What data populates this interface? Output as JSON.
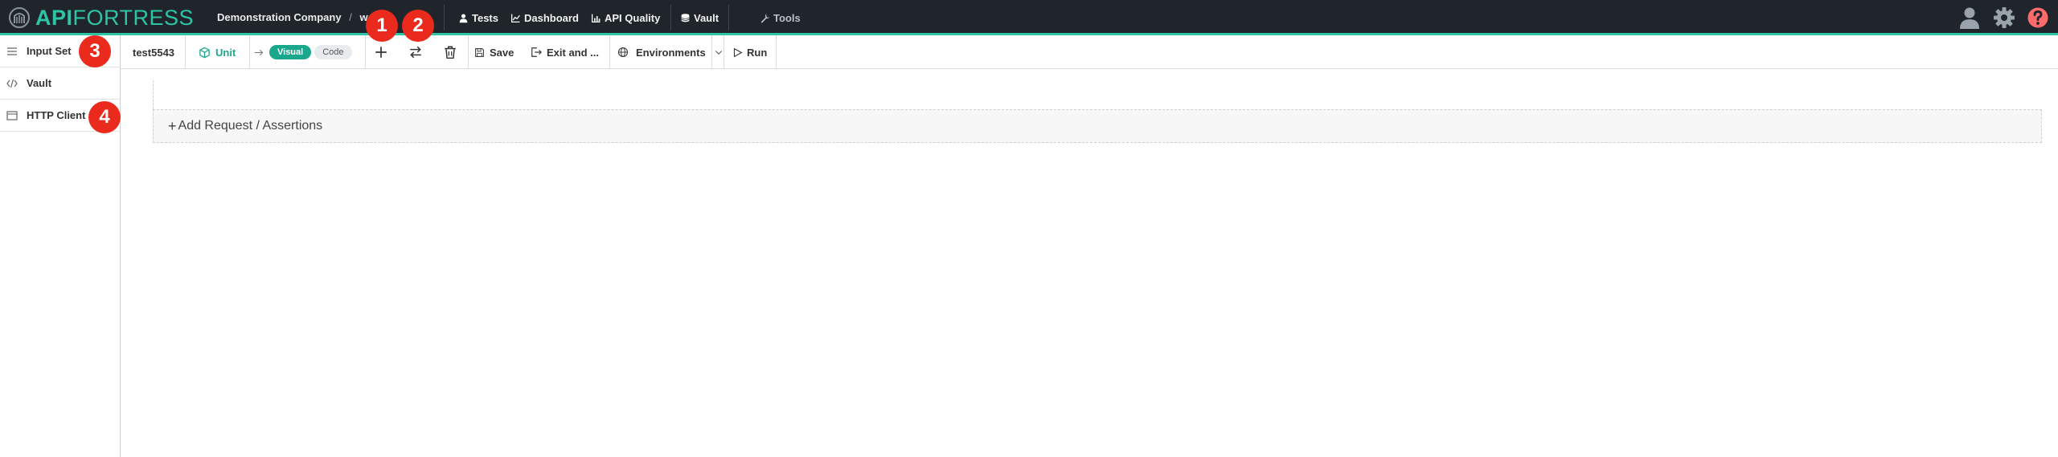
{
  "app": {
    "logo_api": "API",
    "logo_fortress": "FORTRESS",
    "company": "Demonstration Company",
    "separator": "/",
    "workspace": "wo"
  },
  "nav": {
    "tests": "Tests",
    "dashboard": "Dashboard",
    "api_quality": "API Quality",
    "vault": "Vault",
    "tools": "Tools"
  },
  "toolbar": {
    "test_name": "test5543",
    "unit": "Unit",
    "visual": "Visual",
    "code": "Code",
    "save": "Save",
    "exit": "Exit and ...",
    "environments": "Environments",
    "run": "Run"
  },
  "sidebar": {
    "items": [
      {
        "label": "Input Set",
        "icon": "list-icon"
      },
      {
        "label": "Vault",
        "icon": "code-icon"
      },
      {
        "label": "HTTP Client",
        "icon": "window-icon"
      }
    ]
  },
  "main": {
    "add_label": "Add Request / Assertions",
    "add_plus": "+"
  },
  "badges": [
    "1",
    "2",
    "3",
    "4"
  ],
  "colors": {
    "nav_bg": "#1f252b",
    "accent": "#2ec4a6",
    "unit_green": "#19a88c",
    "badge_red": "#ea2a1d"
  }
}
